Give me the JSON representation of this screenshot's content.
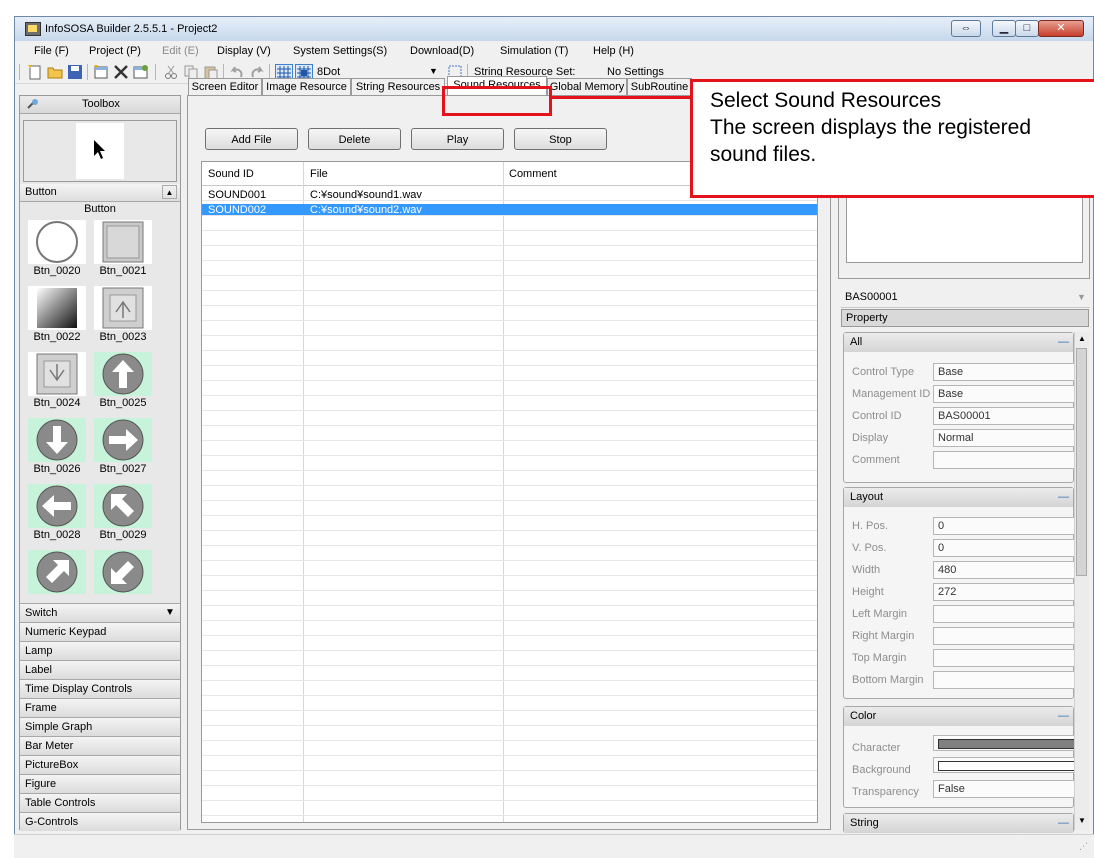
{
  "window": {
    "title": "InfoSOSA Builder 2.5.5.1 - Project2"
  },
  "menu": [
    {
      "label": "File (F)",
      "enabled": true
    },
    {
      "label": "Project (P)",
      "enabled": true
    },
    {
      "label": "Edit (E)",
      "enabled": false
    },
    {
      "label": "Display (V)",
      "enabled": true
    },
    {
      "label": "System Settings(S)",
      "enabled": true
    },
    {
      "label": "Download(D)",
      "enabled": true
    },
    {
      "label": "Simulation (T)",
      "enabled": true
    },
    {
      "label": "Help (H)",
      "enabled": true
    }
  ],
  "toolbar": {
    "grid_size": "8Dot",
    "string_resource_set_label": "String Resource Set:",
    "string_resource_set_value": "No Settings"
  },
  "tabs": [
    {
      "label": "Screen Editor",
      "active": false
    },
    {
      "label": "Image Resource",
      "active": false
    },
    {
      "label": "String Resources",
      "active": false
    },
    {
      "label": "Sound Resources",
      "active": true
    },
    {
      "label": "Global Memory",
      "active": false
    },
    {
      "label": "SubRoutine",
      "active": false
    }
  ],
  "toolbox": {
    "title": "Toolbox",
    "current_category": "Button",
    "section_label": "Button",
    "buttons": [
      "Btn_0020",
      "Btn_0021",
      "Btn_0022",
      "Btn_0023",
      "Btn_0024",
      "Btn_0025",
      "Btn_0026",
      "Btn_0027",
      "Btn_0028",
      "Btn_0029",
      "",
      ""
    ],
    "categories": [
      "Switch",
      "Numeric Keypad",
      "Lamp",
      "Label",
      "Time Display Controls",
      "Frame",
      "Simple Graph",
      "Bar Meter",
      "PictureBox",
      "Figure",
      "Table Controls",
      "G-Controls"
    ]
  },
  "sound_panel": {
    "buttons": {
      "add": "Add File",
      "delete": "Delete",
      "play": "Play",
      "stop": "Stop"
    },
    "columns": [
      "Sound ID",
      "File",
      "Comment"
    ],
    "rows": [
      {
        "id": "SOUND001",
        "file": "C:¥sound¥sound1.wav",
        "comment": "",
        "selected": false
      },
      {
        "id": "SOUND002",
        "file": "C:¥sound¥sound2.wav",
        "comment": "",
        "selected": true
      }
    ]
  },
  "properties": {
    "object": "BAS00001",
    "tab": "Property",
    "groups": {
      "all": {
        "title": "All",
        "items": [
          {
            "label": "Control Type",
            "value": "Base"
          },
          {
            "label": "Management ID",
            "value": "Base"
          },
          {
            "label": "Control ID",
            "value": "BAS00001"
          },
          {
            "label": "Display",
            "value": "Normal"
          },
          {
            "label": "Comment",
            "value": ""
          }
        ]
      },
      "layout": {
        "title": "Layout",
        "items": [
          {
            "label": "H. Pos.",
            "value": "0"
          },
          {
            "label": "V. Pos.",
            "value": "0"
          },
          {
            "label": "Width",
            "value": "480"
          },
          {
            "label": "Height",
            "value": "272"
          },
          {
            "label": "Left Margin",
            "value": ""
          },
          {
            "label": "Right Margin",
            "value": ""
          },
          {
            "label": "Top Margin",
            "value": ""
          },
          {
            "label": "Bottom Margin",
            "value": ""
          }
        ]
      },
      "color": {
        "title": "Color",
        "items": [
          {
            "label": "Character",
            "value": "",
            "swatch": "#808080"
          },
          {
            "label": "Background",
            "value": "",
            "swatch": "#ffffff"
          },
          {
            "label": "Transparency",
            "value": "False"
          }
        ]
      },
      "string": {
        "title": "String"
      }
    }
  },
  "callout": {
    "lines": [
      "Select Sound Resources",
      "The screen displays the registered",
      "sound files."
    ],
    "border_color": "#e3121b"
  }
}
